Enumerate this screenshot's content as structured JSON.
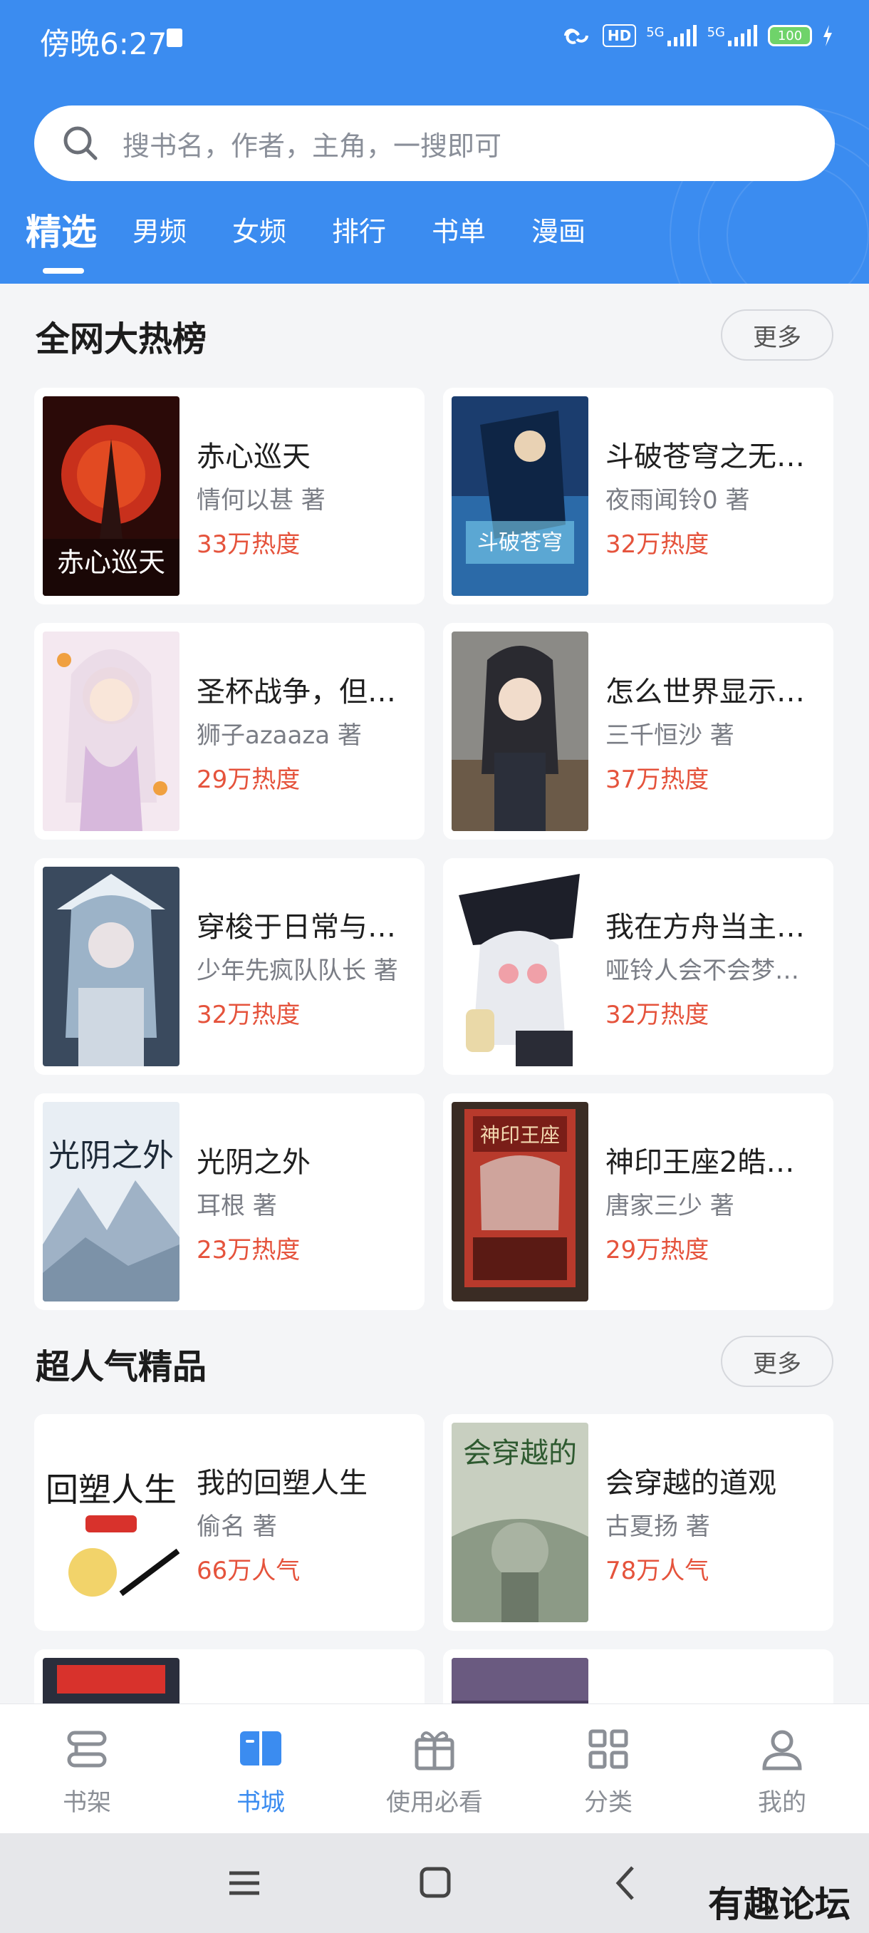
{
  "status_bar": {
    "time": "傍晚6:27",
    "network_1": "5G",
    "network_2": "5G",
    "hd_label": "HD",
    "battery": "100"
  },
  "search": {
    "placeholder": "搜书名，作者，主角，一搜即可"
  },
  "tabs": [
    {
      "label": "精选",
      "active": true
    },
    {
      "label": "男频"
    },
    {
      "label": "女频"
    },
    {
      "label": "排行"
    },
    {
      "label": "书单"
    },
    {
      "label": "漫画"
    }
  ],
  "hot_section": {
    "title": "全网大热榜",
    "more": "更多",
    "books": [
      {
        "title": "赤心巡天",
        "author": "情何以甚 著",
        "heat": "33万热度"
      },
      {
        "title": "斗破苍穹之无…",
        "author": "夜雨闻铃0 著",
        "heat": "32万热度"
      },
      {
        "title": "圣杯战争，但…",
        "author": "狮子azaaza 著",
        "heat": "29万热度"
      },
      {
        "title": "怎么世界显示…",
        "author": "三千恒沙 著",
        "heat": "37万热度"
      },
      {
        "title": "穿梭于日常与…",
        "author": "少年先疯队队长 著",
        "heat": "32万热度"
      },
      {
        "title": "我在方舟当主…",
        "author": "哑铃人会不会梦…",
        "heat": "32万热度"
      },
      {
        "title": "光阴之外",
        "author": "耳根  著",
        "heat": "23万热度"
      },
      {
        "title": "神印王座2皓…",
        "author": "唐家三少 著",
        "heat": "29万热度"
      }
    ]
  },
  "popular_section": {
    "title": "超人气精品",
    "more": "更多",
    "books": [
      {
        "title": "我的回塑人生",
        "author": "偷名 著",
        "heat": "66万人气"
      },
      {
        "title": "会穿越的道观",
        "author": "古夏扬 著",
        "heat": "78万人气"
      }
    ]
  },
  "bottom_nav": [
    {
      "label": "书架",
      "icon": "bookshelf-icon"
    },
    {
      "label": "书城",
      "icon": "book-open-icon",
      "active": true
    },
    {
      "label": "使用必看",
      "icon": "gift-icon"
    },
    {
      "label": "分类",
      "icon": "grid-icon"
    },
    {
      "label": "我的",
      "icon": "user-icon"
    }
  ],
  "watermark": "有趣论坛",
  "colors": {
    "primary": "#3b8cf0",
    "heat": "#e5533c"
  }
}
